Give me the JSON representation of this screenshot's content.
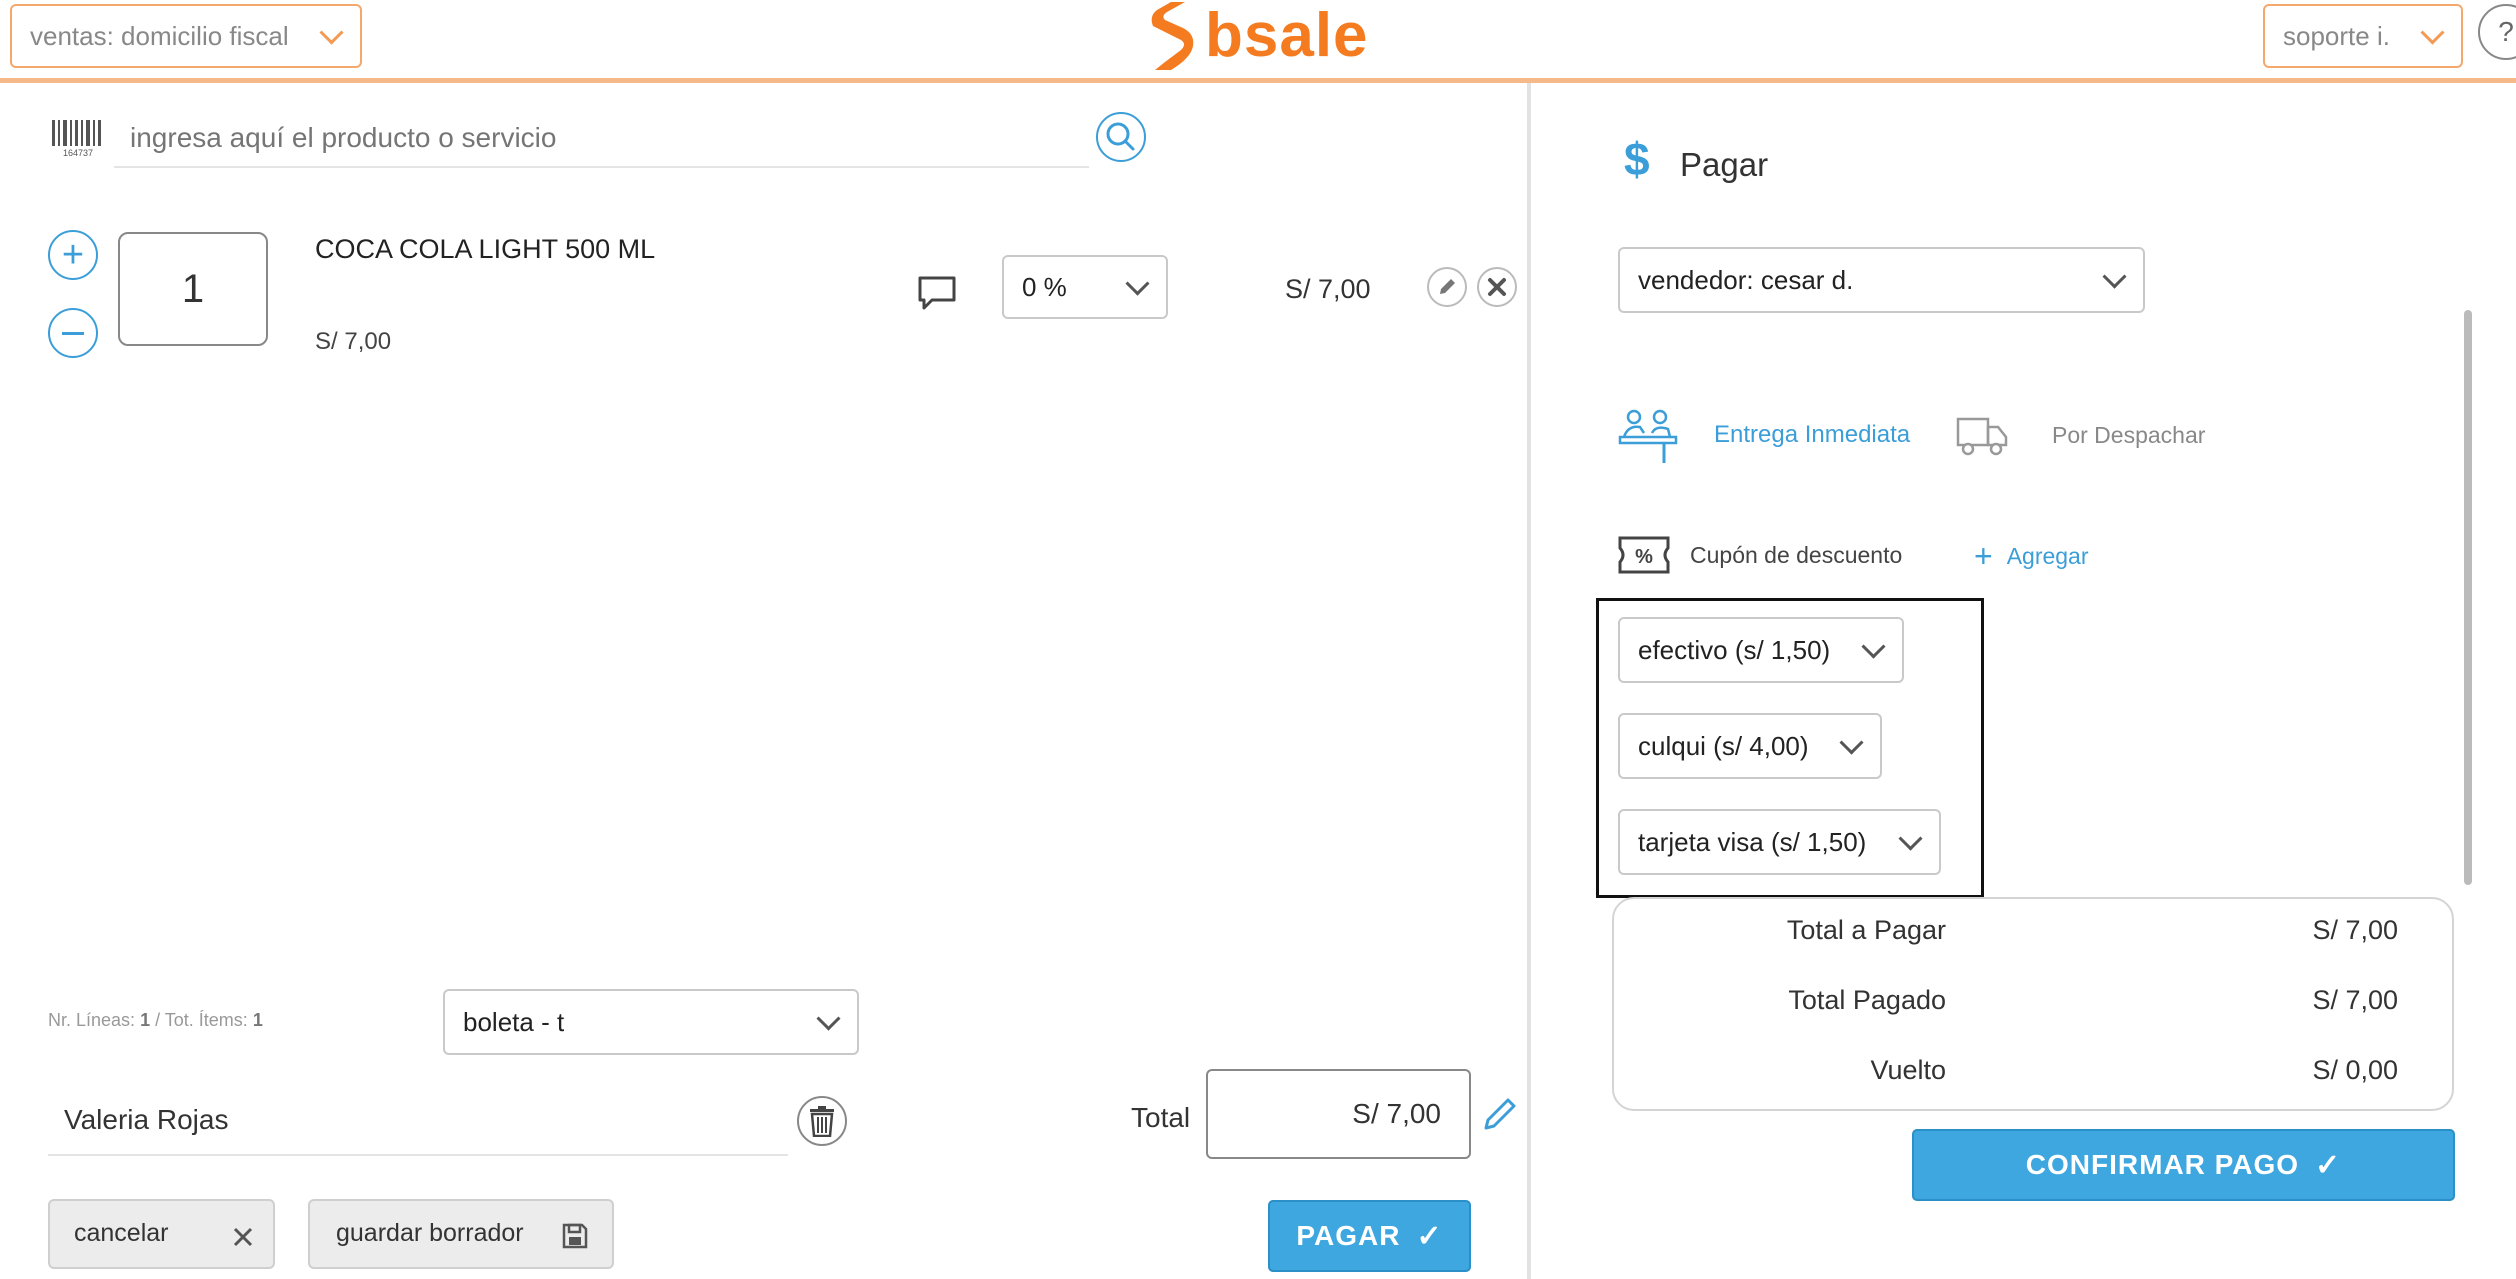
{
  "header": {
    "branch_select": "ventas: domicilio fiscal",
    "logo_text": "bsale",
    "user_select": "soporte i.",
    "help_symbol": "?"
  },
  "colors": {
    "accent_orange": "#f47b20",
    "accent_blue": "#3ea7e0",
    "divider_orange": "#f6b98a"
  },
  "search": {
    "placeholder": "ingresa aquí el producto o servicio",
    "barcode_text": "164737"
  },
  "cart": {
    "item": {
      "quantity": "1",
      "name": "COCA COLA LIGHT 500 ML",
      "unit_price": "S/ 7,00",
      "discount": "0 %",
      "line_total": "S/ 7,00"
    }
  },
  "footer": {
    "lines_label": "Nr. Líneas:",
    "lines_value": "1",
    "items_label": "/ Tot. Ítems:",
    "items_value": "1",
    "doc_type": "boleta - t",
    "client_name": "Valeria Rojas",
    "total_label": "Total",
    "total_value": "S/ 7,00",
    "cancel_label": "cancelar",
    "draft_label": "guardar borrador",
    "pay_label": "PAGAR"
  },
  "payment": {
    "title": "Pagar",
    "seller": "vendedor: cesar d.",
    "delivery_immediate": "Entrega Inmediata",
    "delivery_dispatch": "Por Despachar",
    "coupon_label": "Cupón de descuento",
    "coupon_add": "Agregar",
    "methods": [
      "efectivo (s/ 1,50)",
      "culqui (s/ 4,00)",
      "tarjeta visa (s/ 1,50)"
    ],
    "summary": {
      "total_label": "Total a Pagar",
      "total_value": "S/ 7,00",
      "paid_label": "Total Pagado",
      "paid_value": "S/ 7,00",
      "change_label": "Vuelto",
      "change_value": "S/ 0,00"
    },
    "confirm_label": "CONFIRMAR PAGO"
  }
}
